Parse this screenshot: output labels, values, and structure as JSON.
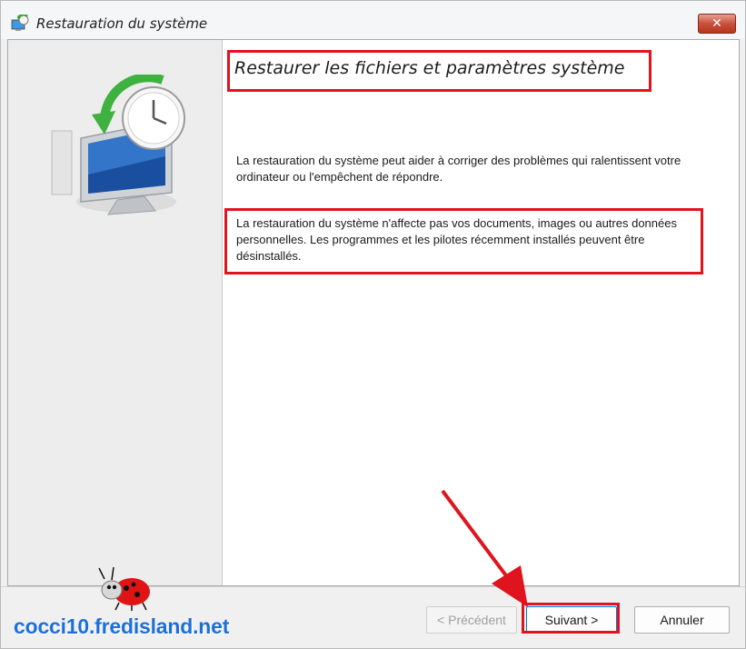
{
  "window": {
    "title": "Restauration du système"
  },
  "main": {
    "heading": "Restaurer les fichiers et paramètres système",
    "paragraph1": "La restauration du système peut aider à corriger des problèmes qui ralentissent votre ordinateur ou l'empêchent de répondre.",
    "paragraph2": "La restauration du système n'affecte pas vos documents, images ou autres données personnelles. Les programmes et les pilotes récemment installés peuvent être désinstallés."
  },
  "footer": {
    "prev_label": "< Précédent",
    "next_label": "Suivant >",
    "cancel_label": "Annuler"
  },
  "watermark": {
    "text": "cocci10.fredisland.net"
  },
  "colors": {
    "highlight": "#e0141e",
    "watermark": "#1e6fd9"
  },
  "icons": {
    "title": "system-restore-icon",
    "hero": "system-restore-clock-monitor-icon",
    "close": "close-icon"
  }
}
